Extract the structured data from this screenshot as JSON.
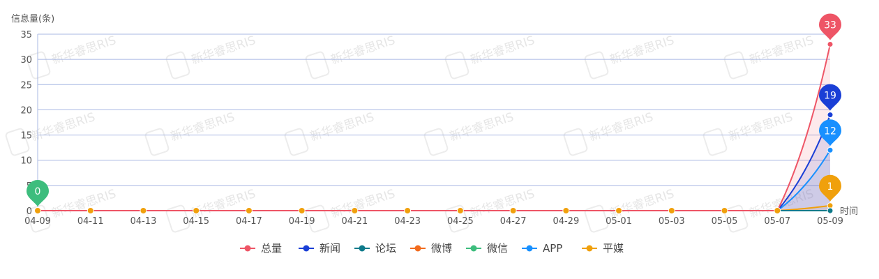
{
  "chart_data": {
    "type": "line",
    "ylabel": "信息量(条)",
    "xlabel": "时间",
    "ylim": [
      0,
      35
    ],
    "y_ticks": [
      0,
      5,
      10,
      15,
      20,
      25,
      30,
      35
    ],
    "x_ticks": [
      "04-09",
      "04-11",
      "04-13",
      "04-15",
      "04-17",
      "04-19",
      "04-21",
      "04-23",
      "04-25",
      "04-27",
      "04-29",
      "05-01",
      "05-03",
      "05-05",
      "05-07",
      "05-09"
    ],
    "grid": true,
    "legend_placement": "bottom-center",
    "watermark": "新华睿思RIS",
    "series": [
      {
        "name": "总量",
        "color": "#ee5566",
        "values": [
          0,
          0,
          0,
          0,
          0,
          0,
          0,
          0,
          0,
          0,
          0,
          0,
          0,
          0,
          0,
          33
        ],
        "pin_label": "33"
      },
      {
        "name": "新闻",
        "color": "#1a3fd6",
        "values": [
          0,
          0,
          0,
          0,
          0,
          0,
          0,
          0,
          0,
          0,
          0,
          0,
          0,
          0,
          0,
          19
        ],
        "pin_label": "19"
      },
      {
        "name": "论坛",
        "color": "#0e7a8a",
        "values": [
          0,
          0,
          0,
          0,
          0,
          0,
          0,
          0,
          0,
          0,
          0,
          0,
          0,
          0,
          0,
          0
        ]
      },
      {
        "name": "微博",
        "color": "#f26b1d",
        "values": [
          0,
          0,
          0,
          0,
          0,
          0,
          0,
          0,
          0,
          0,
          0,
          0,
          0,
          0,
          0,
          0
        ]
      },
      {
        "name": "微信",
        "color": "#3dbd7d",
        "values": [
          0,
          0,
          0,
          0,
          0,
          0,
          0,
          0,
          0,
          0,
          0,
          0,
          0,
          0,
          0,
          0
        ],
        "pin_label": "0",
        "pin_index": 0
      },
      {
        "name": "APP",
        "color": "#1890ff",
        "values": [
          0,
          0,
          0,
          0,
          0,
          0,
          0,
          0,
          0,
          0,
          0,
          0,
          0,
          0,
          0,
          12
        ],
        "pin_label": "12"
      },
      {
        "name": "平媒",
        "color": "#f0a00c",
        "values": [
          0,
          0,
          0,
          0,
          0,
          0,
          0,
          0,
          0,
          0,
          0,
          0,
          0,
          0,
          0,
          1
        ],
        "pin_label": "1"
      }
    ]
  }
}
